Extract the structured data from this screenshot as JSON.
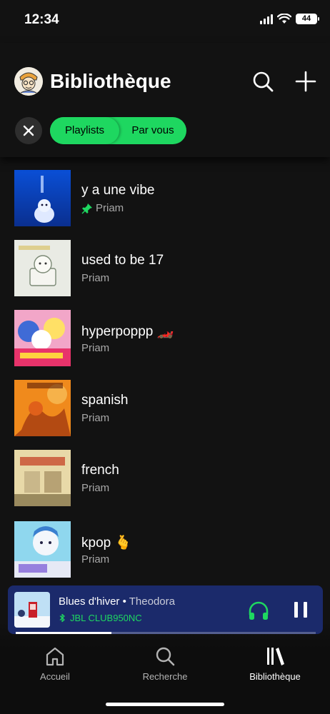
{
  "status_bar": {
    "time": "12:34",
    "battery": "44"
  },
  "header": {
    "title": "Bibliothèque",
    "search_icon": "search-icon",
    "add_icon": "plus-icon"
  },
  "filters": {
    "close_icon": "close-icon",
    "chips": [
      "Playlists",
      "Par vous"
    ],
    "active_chip": "Playlists"
  },
  "playlists": [
    {
      "title": "y a une vibe",
      "owner": "Priam",
      "pinned": true,
      "pin_color": "#1ed760"
    },
    {
      "title": "used to be 17",
      "owner": "Priam",
      "pinned": false
    },
    {
      "title": "hyperpoppp 🏎️",
      "owner": "Priam",
      "pinned": false
    },
    {
      "title": "spanish",
      "owner": "Priam",
      "pinned": false
    },
    {
      "title": "french",
      "owner": "Priam",
      "pinned": false
    },
    {
      "title": "kpop 🫰",
      "owner": "Priam",
      "pinned": false
    }
  ],
  "now_playing": {
    "track": "Blues d'hiver",
    "separator": " • ",
    "artist": "Theodora",
    "device": "JBL CLUB950NC",
    "progress": 0.32,
    "accent_color": "#1ed760",
    "background_color": "#1b2a6b"
  },
  "bottom_nav": [
    {
      "label": "Accueil",
      "icon": "home-icon",
      "active": false
    },
    {
      "label": "Recherche",
      "icon": "search-icon",
      "active": false
    },
    {
      "label": "Bibliothèque",
      "icon": "library-icon",
      "active": true
    }
  ],
  "colors": {
    "background": "#121212",
    "accent": "#1ed760",
    "secondary_text": "#a7a7a7"
  }
}
